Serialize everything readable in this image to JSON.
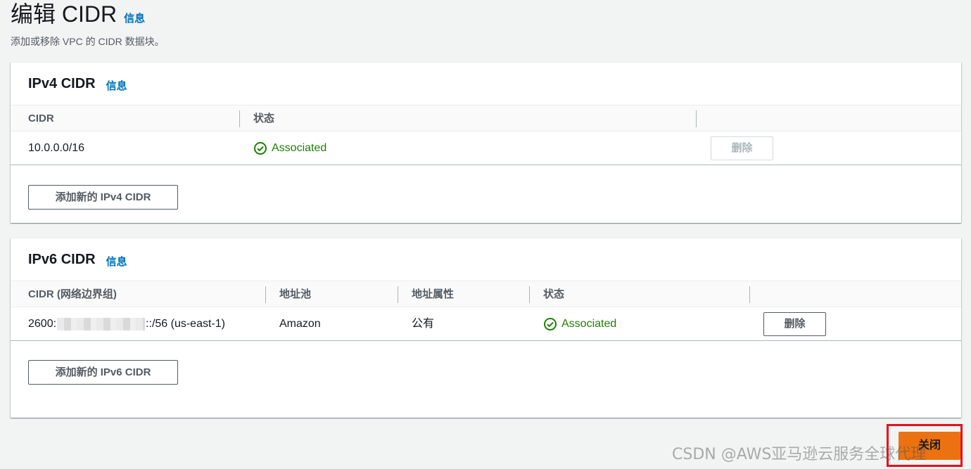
{
  "page": {
    "title": "编辑 CIDR",
    "info": "信息",
    "description": "添加或移除 VPC 的 CIDR 数据块。"
  },
  "ipv4": {
    "title": "IPv4 CIDR",
    "info": "信息",
    "columns": [
      "CIDR",
      "状态"
    ],
    "rows": [
      {
        "cidr": "10.0.0.0/16",
        "status": "Associated",
        "remove_label": "删除",
        "remove_disabled": true
      }
    ],
    "add_label": "添加新的 IPv4 CIDR"
  },
  "ipv6": {
    "title": "IPv6 CIDR",
    "info": "信息",
    "columns": [
      "CIDR (网络边界组)",
      "地址池",
      "地址属性",
      "状态"
    ],
    "rows": [
      {
        "cidr_prefix": "2600:",
        "cidr_suffix": "::/56 (us-east-1)",
        "pool": "Amazon",
        "attribute": "公有",
        "status": "Associated",
        "remove_label": "删除"
      }
    ],
    "add_label": "添加新的 IPv6 CIDR"
  },
  "footer": {
    "close_label": "关闭"
  },
  "watermark": "CSDN @AWS亚马逊云服务全球代理",
  "colors": {
    "accent": "#ec7211",
    "link": "#0073bb",
    "success": "#1d8102",
    "highlight": "#e8101c"
  },
  "icons": {
    "status": "check-circle-icon"
  }
}
